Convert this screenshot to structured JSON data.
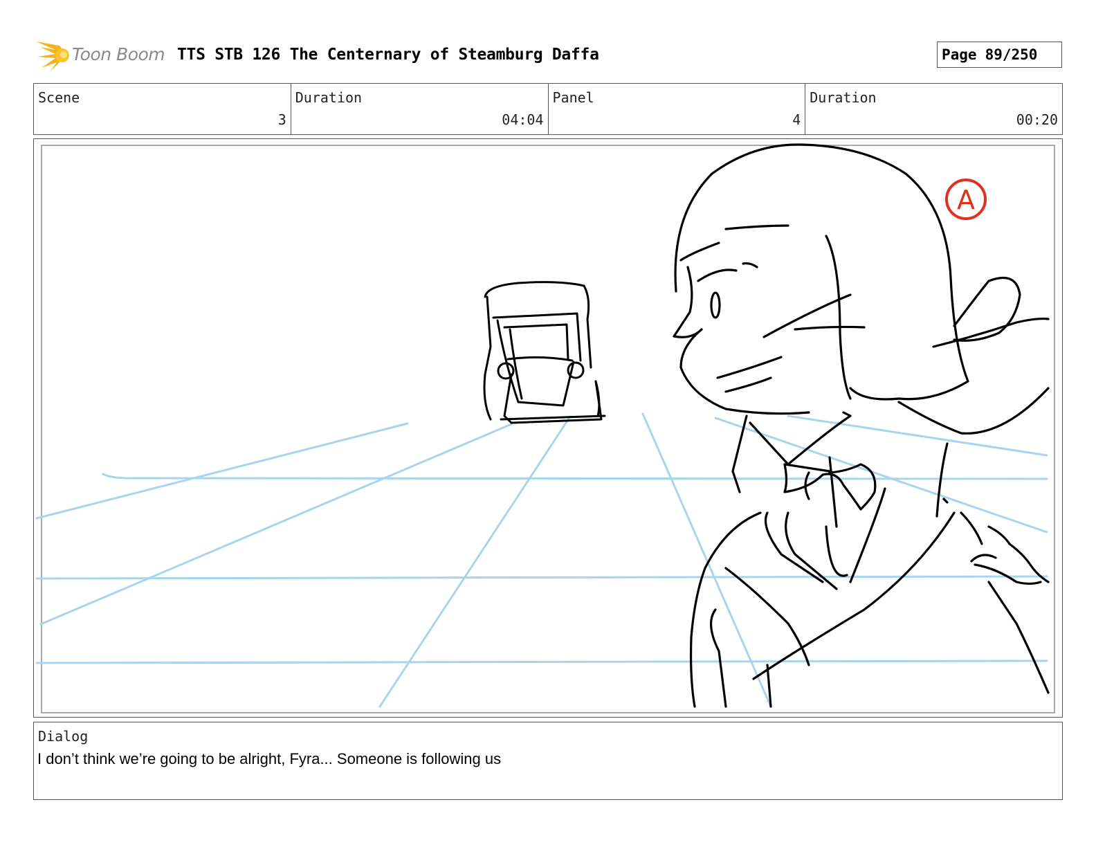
{
  "header": {
    "logo_text": "Toon Boom",
    "title": "TTS STB 126 The Centernary of Steamburg Daffa",
    "page_label": "Page",
    "page_number": "89/250"
  },
  "info": {
    "scene_label": "Scene",
    "scene_value": "3",
    "scene_duration_label": "Duration",
    "scene_duration_value": "04:04",
    "panel_label": "Panel",
    "panel_value": "4",
    "panel_duration_label": "Duration",
    "panel_duration_value": "00:20"
  },
  "panel": {
    "annotation_mark": "A",
    "colors": {
      "guide_lines": "#a9d4ee",
      "ink": "#000000",
      "annotation": "#e0301e"
    }
  },
  "dialog": {
    "label": "Dialog",
    "text": "I don’t think we’re going to be alright, Fyra... Someone is following us"
  }
}
